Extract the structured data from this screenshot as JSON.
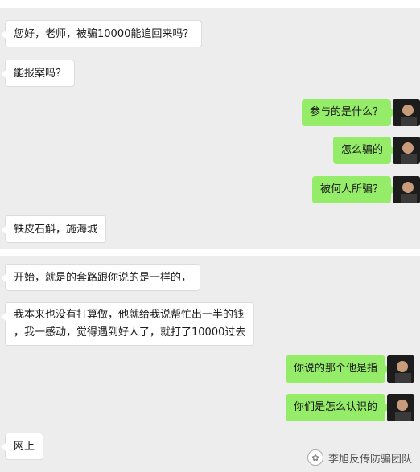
{
  "chat": {
    "messages_top": [
      {
        "side": "left",
        "text": "您好，老师，被骗10000能追回来吗？"
      },
      {
        "side": "left",
        "text": "能报案吗？"
      },
      {
        "side": "right",
        "text": "参与的是什么？"
      },
      {
        "side": "right",
        "text": "怎么骗的"
      },
      {
        "side": "right",
        "text": "被何人所骗？"
      },
      {
        "side": "left",
        "text": "铁皮石斛，施海城"
      }
    ],
    "messages_bottom": [
      {
        "side": "left",
        "text": "开始，就是的套路跟你说的是一样的，"
      },
      {
        "side": "left",
        "line1": "我本来也没有打算做，他就给我说帮忙出一半的钱",
        "line2": "，我一感动，觉得遇到好人了，就打了10000过去"
      },
      {
        "side": "right",
        "text": "你说的那个他是指"
      },
      {
        "side": "right",
        "text": "你们是怎么认识的"
      },
      {
        "side": "left",
        "text": "网上"
      }
    ]
  },
  "watermark": {
    "text": "李旭反传防骗团队",
    "icon": "wechat-official-account-icon"
  },
  "colors": {
    "outgoing_bubble": "#95ec69",
    "incoming_bubble": "#ffffff",
    "background": "#ededed"
  }
}
